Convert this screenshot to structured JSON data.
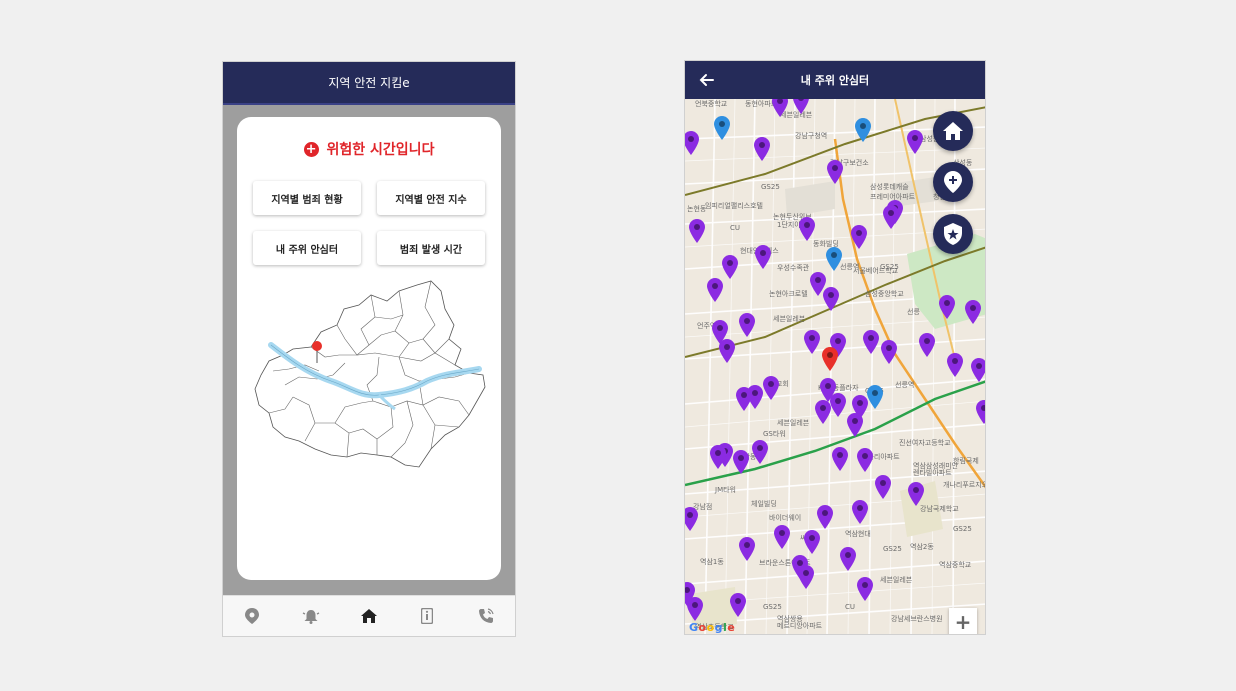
{
  "left_screen": {
    "title": "지역 안전 지킴e",
    "alert": {
      "text": "위험한 시간입니다",
      "color": "#e0252a"
    },
    "menu": [
      {
        "label": "지역별 범죄 현황"
      },
      {
        "label": "지역별 안전 지수"
      },
      {
        "label": "내 주위 안심터"
      },
      {
        "label": "범죄 발생 시간"
      }
    ],
    "bottom_nav": [
      "location-pin-icon",
      "alarm-bell-icon",
      "home-icon",
      "info-card-icon",
      "phone-call-icon"
    ],
    "colors": {
      "appbar": "#252b59",
      "river": "#a7d8f0"
    }
  },
  "right_screen": {
    "title": "내 주위 안심터",
    "fabs": [
      "home-icon",
      "add-location-icon",
      "shield-star-icon"
    ],
    "zoom": {
      "in": "+",
      "out": "−"
    },
    "map_labels": [
      "언북중학교",
      "동현아파트",
      "세븐일레븐",
      "강남구청역",
      "강남구보건소",
      "삼성현대",
      "삼성동",
      "청담역",
      "GS25",
      "임피리얼팰리스호텔",
      "삼성롯데캐슬",
      "프레미어아파트",
      "논현동",
      "CU",
      "논현두산위브",
      "1단지아파트",
      "현대인텔렉스",
      "동화빌딩",
      "선릉역",
      "서울베어드학교",
      "우성수족관",
      "GS25",
      "논현아크로텔",
      "삼성중앙학교",
      "세븐일레븐",
      "언주역",
      "선릉",
      "충현교회",
      "KT강동플라자",
      "선릉역",
      "세븐일레븐",
      "GS25",
      "GS타워",
      "진선여자고등학교",
      "개나리아파트",
      "역삼삼성래미안",
      "렌타빌아파트",
      "한림국제",
      "역삼동",
      "JM타워",
      "체일빌딩",
      "바이더웨이",
      "강남점",
      "개나리푸르지오",
      "강남국제학교",
      "씨네로",
      "역삼현대",
      "브라운스톤아파트",
      "GS25",
      "역삼2동",
      "GS25",
      "역삼중학교",
      "역삼1동",
      "세븐일레븐",
      "역삼초등학교",
      "역삼쌍용",
      "메르디앙아파트",
      "강남세브란스병원",
      "GS25",
      "CU"
    ],
    "google": "Google",
    "colors": {
      "purple_pin": "#8b2be2",
      "blue_pin": "#2f8fe0",
      "red_pin": "#e8302a",
      "subway_green": "#2aa14a",
      "subway_olive": "#7c7a2a",
      "orange_road": "#f0a53a"
    }
  }
}
